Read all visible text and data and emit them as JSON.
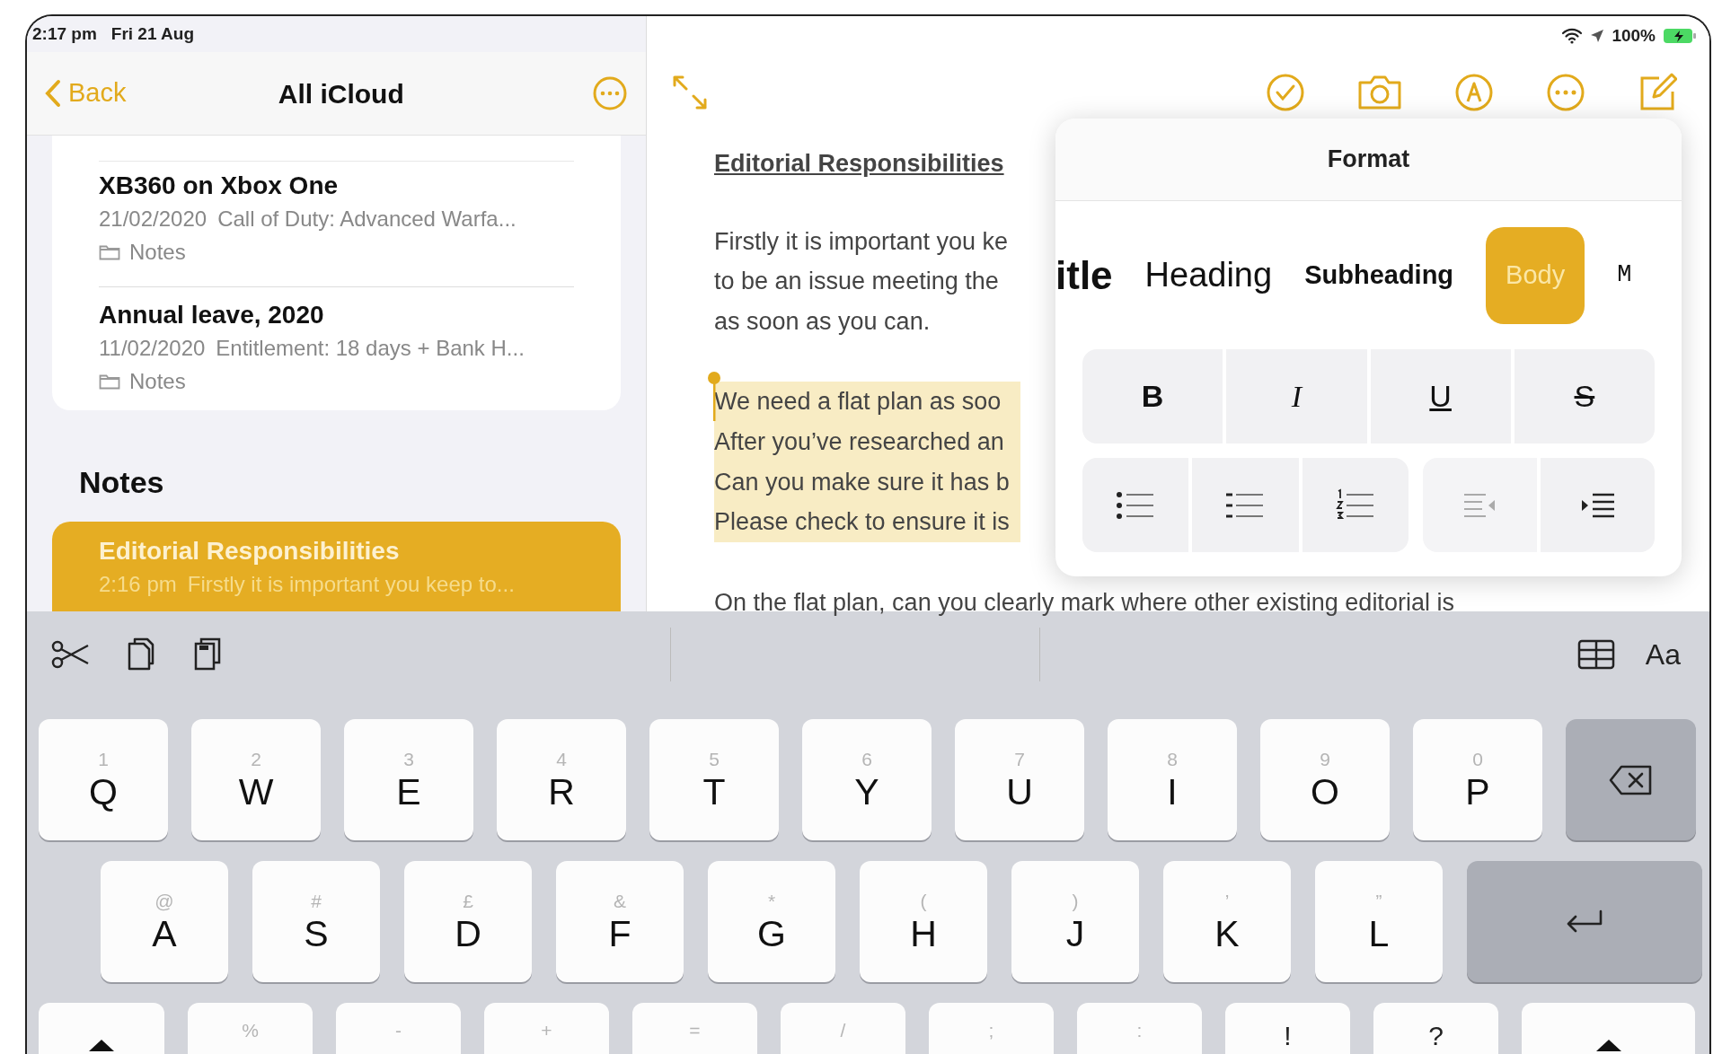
{
  "status_bar": {
    "time": "2:17 pm",
    "date": "Fri 21 Aug",
    "battery": "100%"
  },
  "sidebar": {
    "back": "Back",
    "title": "All iCloud",
    "groups": [
      {
        "notes": [
          {
            "title": "XB360 on Xbox One",
            "date": "21/02/2020",
            "preview": "Call of Duty: Advanced Warfa...",
            "folder": "Notes",
            "selected": false
          },
          {
            "title": "Annual leave, 2020",
            "date": "11/02/2020",
            "preview": "Entitlement: 18 days + Bank H...",
            "folder": "Notes",
            "selected": false
          }
        ]
      },
      {
        "heading": "Notes",
        "notes": [
          {
            "title": "Editorial Responsibilities",
            "date": "2:16 pm",
            "preview": "Firstly it is important you keep to...",
            "selected": true
          }
        ]
      }
    ]
  },
  "editor": {
    "heading": "Editorial Responsibilities",
    "paragraphs": [
      {
        "highlighted": false,
        "lines": [
          "Firstly it is important you ke",
          "to be an issue meeting the",
          "as soon as you can."
        ]
      },
      {
        "highlighted": true,
        "lines": [
          "We need a flat plan as soo",
          "After you’ve researched an",
          "Can you make sure it has b",
          "Please check to ensure it is"
        ]
      },
      {
        "highlighted": false,
        "lines": [
          "On the flat plan, can you clearly mark where other existing editorial is"
        ]
      }
    ]
  },
  "format_panel": {
    "title": "Format",
    "styles": [
      {
        "label": "itle",
        "kind": "title",
        "selected": false
      },
      {
        "label": "Heading",
        "kind": "heading",
        "selected": false
      },
      {
        "label": "Subheading",
        "kind": "subheading",
        "selected": false
      },
      {
        "label": "Body",
        "kind": "body",
        "selected": true
      },
      {
        "label": "M",
        "kind": "mono",
        "selected": false
      }
    ],
    "text_styles": [
      {
        "label": "B",
        "kind": "bold"
      },
      {
        "label": "I",
        "kind": "italic"
      },
      {
        "label": "U",
        "kind": "underline"
      },
      {
        "label": "S",
        "kind": "strike"
      }
    ]
  },
  "keyboard": {
    "toolbar_label": "Aa",
    "rows": [
      {
        "keys": [
          {
            "kind": "letter",
            "label": "Q",
            "hint": "1"
          },
          {
            "kind": "letter",
            "label": "W",
            "hint": "2"
          },
          {
            "kind": "letter",
            "label": "E",
            "hint": "3"
          },
          {
            "kind": "letter",
            "label": "R",
            "hint": "4"
          },
          {
            "kind": "letter",
            "label": "T",
            "hint": "5"
          },
          {
            "kind": "letter",
            "label": "Y",
            "hint": "6"
          },
          {
            "kind": "letter",
            "label": "U",
            "hint": "7"
          },
          {
            "kind": "letter",
            "label": "I",
            "hint": "8"
          },
          {
            "kind": "letter",
            "label": "O",
            "hint": "9"
          },
          {
            "kind": "letter",
            "label": "P",
            "hint": "0"
          },
          {
            "kind": "delete"
          }
        ]
      },
      {
        "keys": [
          {
            "kind": "letter",
            "label": "A",
            "hint": "@"
          },
          {
            "kind": "letter",
            "label": "S",
            "hint": "#"
          },
          {
            "kind": "letter",
            "label": "D",
            "hint": "£"
          },
          {
            "kind": "letter",
            "label": "F",
            "hint": "&"
          },
          {
            "kind": "letter",
            "label": "G",
            "hint": "*"
          },
          {
            "kind": "letter",
            "label": "H",
            "hint": "("
          },
          {
            "kind": "letter",
            "label": "J",
            "hint": ")"
          },
          {
            "kind": "letter",
            "label": "K",
            "hint": "’"
          },
          {
            "kind": "letter",
            "label": "L",
            "hint": "”"
          },
          {
            "kind": "return"
          }
        ]
      },
      {
        "keys": [
          {
            "kind": "shift"
          },
          {
            "kind": "cut",
            "hint": "%"
          },
          {
            "kind": "cut",
            "hint": "-"
          },
          {
            "kind": "cut",
            "hint": "+"
          },
          {
            "kind": "cut",
            "hint": "="
          },
          {
            "kind": "cut",
            "hint": "/"
          },
          {
            "kind": "cut",
            "hint": ";"
          },
          {
            "kind": "cut",
            "hint": ":"
          },
          {
            "kind": "punct",
            "hint": "!"
          },
          {
            "kind": "punct",
            "hint": "?"
          },
          {
            "kind": "shift"
          }
        ]
      }
    ]
  }
}
